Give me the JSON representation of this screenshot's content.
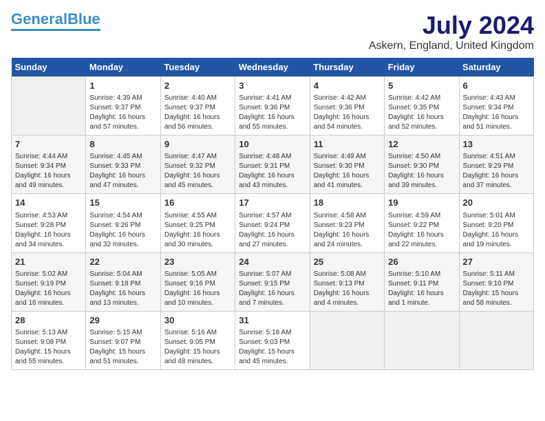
{
  "logo": {
    "line1": "General",
    "line2": "Blue"
  },
  "title": "July 2024",
  "location": "Askern, England, United Kingdom",
  "days_of_week": [
    "Sunday",
    "Monday",
    "Tuesday",
    "Wednesday",
    "Thursday",
    "Friday",
    "Saturday"
  ],
  "weeks": [
    [
      {
        "day": "",
        "info": ""
      },
      {
        "day": "1",
        "info": "Sunrise: 4:39 AM\nSunset: 9:37 PM\nDaylight: 16 hours\nand 57 minutes."
      },
      {
        "day": "2",
        "info": "Sunrise: 4:40 AM\nSunset: 9:37 PM\nDaylight: 16 hours\nand 56 minutes."
      },
      {
        "day": "3",
        "info": "Sunrise: 4:41 AM\nSunset: 9:36 PM\nDaylight: 16 hours\nand 55 minutes."
      },
      {
        "day": "4",
        "info": "Sunrise: 4:42 AM\nSunset: 9:36 PM\nDaylight: 16 hours\nand 54 minutes."
      },
      {
        "day": "5",
        "info": "Sunrise: 4:42 AM\nSunset: 9:35 PM\nDaylight: 16 hours\nand 52 minutes."
      },
      {
        "day": "6",
        "info": "Sunrise: 4:43 AM\nSunset: 9:34 PM\nDaylight: 16 hours\nand 51 minutes."
      }
    ],
    [
      {
        "day": "7",
        "info": "Sunrise: 4:44 AM\nSunset: 9:34 PM\nDaylight: 16 hours\nand 49 minutes."
      },
      {
        "day": "8",
        "info": "Sunrise: 4:45 AM\nSunset: 9:33 PM\nDaylight: 16 hours\nand 47 minutes."
      },
      {
        "day": "9",
        "info": "Sunrise: 4:47 AM\nSunset: 9:32 PM\nDaylight: 16 hours\nand 45 minutes."
      },
      {
        "day": "10",
        "info": "Sunrise: 4:48 AM\nSunset: 9:31 PM\nDaylight: 16 hours\nand 43 minutes."
      },
      {
        "day": "11",
        "info": "Sunrise: 4:49 AM\nSunset: 9:30 PM\nDaylight: 16 hours\nand 41 minutes."
      },
      {
        "day": "12",
        "info": "Sunrise: 4:50 AM\nSunset: 9:30 PM\nDaylight: 16 hours\nand 39 minutes."
      },
      {
        "day": "13",
        "info": "Sunrise: 4:51 AM\nSunset: 9:29 PM\nDaylight: 16 hours\nand 37 minutes."
      }
    ],
    [
      {
        "day": "14",
        "info": "Sunrise: 4:53 AM\nSunset: 9:28 PM\nDaylight: 16 hours\nand 34 minutes."
      },
      {
        "day": "15",
        "info": "Sunrise: 4:54 AM\nSunset: 9:26 PM\nDaylight: 16 hours\nand 32 minutes."
      },
      {
        "day": "16",
        "info": "Sunrise: 4:55 AM\nSunset: 9:25 PM\nDaylight: 16 hours\nand 30 minutes."
      },
      {
        "day": "17",
        "info": "Sunrise: 4:57 AM\nSunset: 9:24 PM\nDaylight: 16 hours\nand 27 minutes."
      },
      {
        "day": "18",
        "info": "Sunrise: 4:58 AM\nSunset: 9:23 PM\nDaylight: 16 hours\nand 24 minutes."
      },
      {
        "day": "19",
        "info": "Sunrise: 4:59 AM\nSunset: 9:22 PM\nDaylight: 16 hours\nand 22 minutes."
      },
      {
        "day": "20",
        "info": "Sunrise: 5:01 AM\nSunset: 9:20 PM\nDaylight: 16 hours\nand 19 minutes."
      }
    ],
    [
      {
        "day": "21",
        "info": "Sunrise: 5:02 AM\nSunset: 9:19 PM\nDaylight: 16 hours\nand 16 minutes."
      },
      {
        "day": "22",
        "info": "Sunrise: 5:04 AM\nSunset: 9:18 PM\nDaylight: 16 hours\nand 13 minutes."
      },
      {
        "day": "23",
        "info": "Sunrise: 5:05 AM\nSunset: 9:16 PM\nDaylight: 16 hours\nand 10 minutes."
      },
      {
        "day": "24",
        "info": "Sunrise: 5:07 AM\nSunset: 9:15 PM\nDaylight: 16 hours\nand 7 minutes."
      },
      {
        "day": "25",
        "info": "Sunrise: 5:08 AM\nSunset: 9:13 PM\nDaylight: 16 hours\nand 4 minutes."
      },
      {
        "day": "26",
        "info": "Sunrise: 5:10 AM\nSunset: 9:11 PM\nDaylight: 16 hours\nand 1 minute."
      },
      {
        "day": "27",
        "info": "Sunrise: 5:11 AM\nSunset: 9:10 PM\nDaylight: 15 hours\nand 58 minutes."
      }
    ],
    [
      {
        "day": "28",
        "info": "Sunrise: 5:13 AM\nSunset: 9:08 PM\nDaylight: 15 hours\nand 55 minutes."
      },
      {
        "day": "29",
        "info": "Sunrise: 5:15 AM\nSunset: 9:07 PM\nDaylight: 15 hours\nand 51 minutes."
      },
      {
        "day": "30",
        "info": "Sunrise: 5:16 AM\nSunset: 9:05 PM\nDaylight: 15 hours\nand 48 minutes."
      },
      {
        "day": "31",
        "info": "Sunrise: 5:18 AM\nSunset: 9:03 PM\nDaylight: 15 hours\nand 45 minutes."
      },
      {
        "day": "",
        "info": ""
      },
      {
        "day": "",
        "info": ""
      },
      {
        "day": "",
        "info": ""
      }
    ]
  ]
}
